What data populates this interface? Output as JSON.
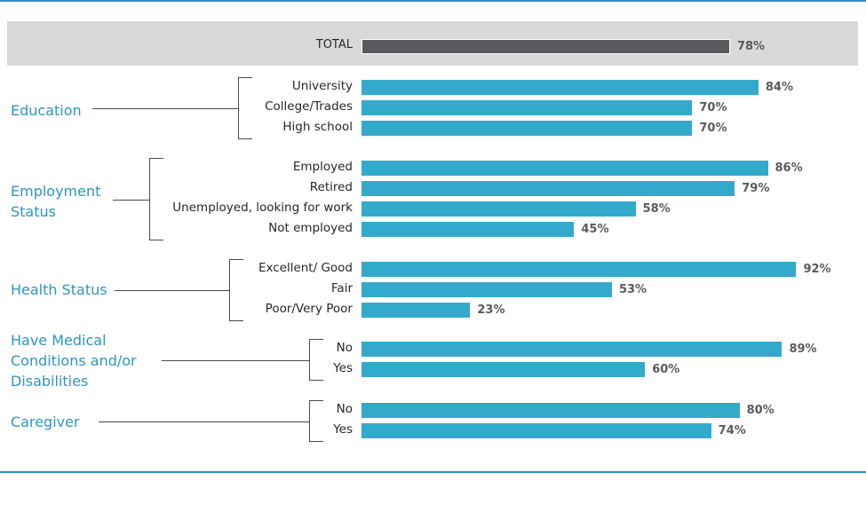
{
  "chart_data": {
    "type": "bar",
    "orientation": "horizontal",
    "title": "",
    "xlabel": "",
    "ylabel": "",
    "xlim": [
      0,
      100
    ],
    "grid": false,
    "value_suffix": "%",
    "total": {
      "label": "TOTAL",
      "value": 78,
      "display": "78%"
    },
    "groups": [
      {
        "name": "Education",
        "categories": [
          {
            "label": "University",
            "value": 84,
            "display": "84%"
          },
          {
            "label": "College/Trades",
            "value": 70,
            "display": "70%"
          },
          {
            "label": "High school",
            "value": 70,
            "display": "70%"
          }
        ]
      },
      {
        "name": "Employment Status",
        "categories": [
          {
            "label": "Employed",
            "value": 86,
            "display": "86%"
          },
          {
            "label": "Retired",
            "value": 79,
            "display": "79%"
          },
          {
            "label": "Unemployed, looking for work",
            "value": 58,
            "display": "58%"
          },
          {
            "label": "Not employed",
            "value": 45,
            "display": "45%"
          }
        ]
      },
      {
        "name": "Health Status",
        "categories": [
          {
            "label": "Excellent/ Good",
            "value": 92,
            "display": "92%"
          },
          {
            "label": "Fair",
            "value": 53,
            "display": "53%"
          },
          {
            "label": "Poor/Very Poor",
            "value": 23,
            "display": "23%"
          }
        ]
      },
      {
        "name": "Have Medical Conditions and/or Disabilities",
        "categories": [
          {
            "label": "No",
            "value": 89,
            "display": "89%"
          },
          {
            "label": "Yes",
            "value": 60,
            "display": "60%"
          }
        ]
      },
      {
        "name": "Caregiver",
        "categories": [
          {
            "label": "No",
            "value": 80,
            "display": "80%"
          },
          {
            "label": "Yes",
            "value": 74,
            "display": "74%"
          }
        ]
      }
    ],
    "colors": {
      "total_bar": "#595a5e",
      "bar": "#33a9cc",
      "group_label": "#2e95c2",
      "total_band": "#d9d9d9",
      "rule": "#2f8fc4"
    }
  },
  "group_label_lines": [
    [
      "Education"
    ],
    [
      "Employment",
      "Status"
    ],
    [
      "Health Status"
    ],
    [
      "Have Medical",
      "Conditions and/or",
      "Disabilities"
    ],
    [
      "Caregiver"
    ]
  ]
}
